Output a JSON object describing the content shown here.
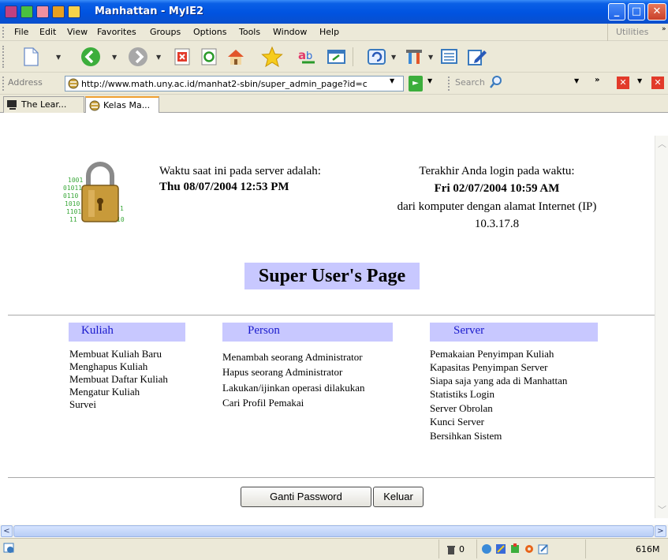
{
  "window": {
    "title": "Manhattan - MyIE2"
  },
  "menu": {
    "items": [
      {
        "label": "File"
      },
      {
        "label": "Edit"
      },
      {
        "label": "View"
      },
      {
        "label": "Favorites"
      },
      {
        "label": "Groups"
      },
      {
        "label": "Options"
      },
      {
        "label": "Tools"
      },
      {
        "label": "Window"
      },
      {
        "label": "Help"
      }
    ],
    "utilities_label": "Utilities"
  },
  "address": {
    "label": "Address",
    "url": "http://www.math.uny.ac.id/manhat2-sbin/super_admin_page?id=c",
    "search_label": "Search"
  },
  "tabs": [
    {
      "label": "The Lear..."
    },
    {
      "label": "Kelas Ma..."
    }
  ],
  "server_time": {
    "label": "Waktu saat ini pada server adalah:",
    "value": "Thu 08/07/2004 12:53 PM"
  },
  "last_login": {
    "label": "Terakhir Anda login pada waktu:",
    "value": "Fri 02/07/2004 10:59 AM",
    "ip_label": "dari komputer dengan alamat Internet (IP)",
    "ip": "10.3.17.8"
  },
  "page_title": "Super User's Page",
  "sections": {
    "kuliah": {
      "title": "Kuliah",
      "links": [
        "Membuat Kuliah Baru",
        "Menghapus Kuliah",
        "Membuat Daftar Kuliah",
        "Mengatur Kuliah",
        "Survei"
      ]
    },
    "person": {
      "title": "Person",
      "links": [
        "Menambah seorang Administrator",
        "Hapus seorang Administrator",
        "Lakukan/ijinkan operasi dilakukan",
        "Cari Profil Pemakai"
      ]
    },
    "server": {
      "title": "Server",
      "links": [
        "Pemakaian Penyimpan Kuliah",
        "Kapasitas Penyimpan Server",
        "Siapa saja yang ada di Manhattan",
        "Statistiks Login",
        "Server Obrolan",
        "Kunci Server",
        "Bersihkan Sistem"
      ]
    }
  },
  "buttons": {
    "change_password": "Ganti Password",
    "logout": "Keluar"
  },
  "status": {
    "trash_count": "0",
    "memory": "616M"
  },
  "colors": {
    "titlebar": "#0053e0",
    "section_header_bg": "#c8c8ff",
    "section_header_text": "#1a1acc",
    "chrome": "#ece9d8"
  }
}
